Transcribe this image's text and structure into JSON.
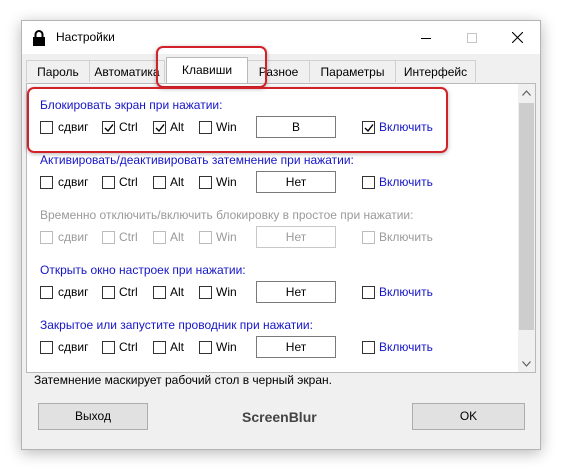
{
  "window": {
    "title": "Настройки",
    "icon": "lock-icon"
  },
  "titlebar_buttons": {
    "minimize": "minimize-icon",
    "maximize": "maximize-icon",
    "close": "close-icon"
  },
  "tabs": [
    {
      "label": "Пароль",
      "active": false
    },
    {
      "label": "Автоматика",
      "active": false
    },
    {
      "label": "Клавиши",
      "active": true
    },
    {
      "label": "Разное",
      "active": false
    },
    {
      "label": "Параметры",
      "active": false
    },
    {
      "label": "Интерфейс",
      "active": false
    }
  ],
  "sections": [
    {
      "title": "Блокировать экран при нажатии:",
      "enabled": true,
      "shift_label": "сдвиг",
      "shift_checked": false,
      "ctrl_label": "Ctrl",
      "ctrl_checked": true,
      "alt_label": "Alt",
      "alt_checked": true,
      "win_label": "Win",
      "win_checked": false,
      "key": "B",
      "enable_label": "Включить",
      "enable_checked": true
    },
    {
      "title": "Активировать/деактивировать затемнение при нажатии:",
      "enabled": true,
      "shift_label": "сдвиг",
      "shift_checked": false,
      "ctrl_label": "Ctrl",
      "ctrl_checked": false,
      "alt_label": "Alt",
      "alt_checked": false,
      "win_label": "Win",
      "win_checked": false,
      "key": "Нет",
      "enable_label": "Включить",
      "enable_checked": false
    },
    {
      "title": "Временно отключить/включить блокировку в простое при нажатии:",
      "enabled": false,
      "shift_label": "сдвиг",
      "shift_checked": false,
      "ctrl_label": "Ctrl",
      "ctrl_checked": false,
      "alt_label": "Alt",
      "alt_checked": false,
      "win_label": "Win",
      "win_checked": false,
      "key": "Нет",
      "enable_label": "Включить",
      "enable_checked": false
    },
    {
      "title": "Открыть окно настроек при нажатии:",
      "enabled": true,
      "shift_label": "сдвиг",
      "shift_checked": false,
      "ctrl_label": "Ctrl",
      "ctrl_checked": false,
      "alt_label": "Alt",
      "alt_checked": false,
      "win_label": "Win",
      "win_checked": false,
      "key": "Нет",
      "enable_label": "Включить",
      "enable_checked": false
    },
    {
      "title": "Закрытое или запустите проводник при нажатии:",
      "enabled": true,
      "shift_label": "сдвиг",
      "shift_checked": false,
      "ctrl_label": "Ctrl",
      "ctrl_checked": false,
      "alt_label": "Alt",
      "alt_checked": false,
      "win_label": "Win",
      "win_checked": false,
      "key": "Нет",
      "enable_label": "Включить",
      "enable_checked": false
    }
  ],
  "status_text": "Затемнение маскирует рабочий стол в черный экран.",
  "footer": {
    "exit_label": "Выход",
    "brand": "ScreenBlur",
    "ok_label": "OK"
  },
  "colors": {
    "accent_text": "#1515c8",
    "highlight": "#d22128",
    "disabled_text": "#9a9a9a"
  }
}
